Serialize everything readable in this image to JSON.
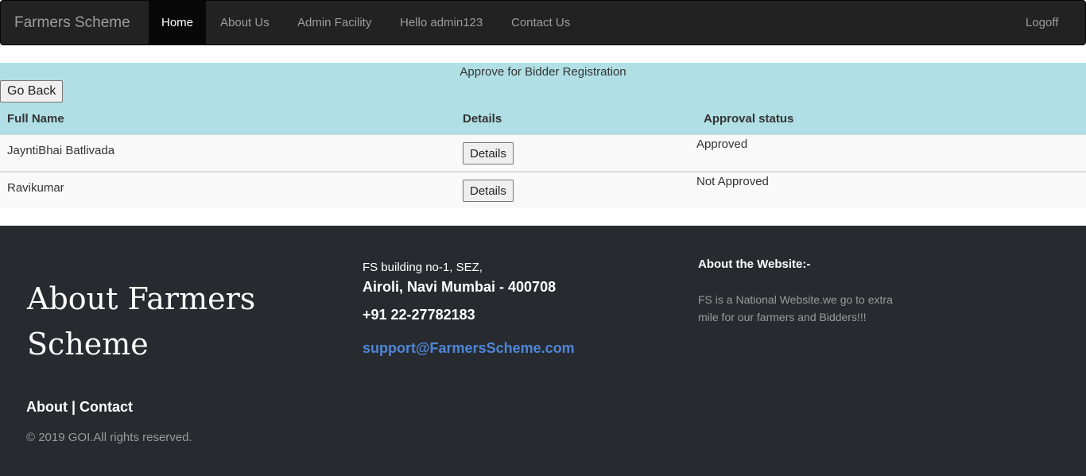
{
  "navbar": {
    "brand": "Farmers Scheme",
    "items": [
      {
        "label": "Home"
      },
      {
        "label": "About Us"
      },
      {
        "label": "Admin Facility"
      },
      {
        "label": "Hello admin123"
      },
      {
        "label": "Contact Us"
      }
    ],
    "logoff": "Logoff"
  },
  "approval": {
    "title": "Approve for Bidder Registration",
    "go_back": "Go Back",
    "columns": [
      "Full Name",
      "Details",
      "Approval status"
    ],
    "rows": [
      {
        "name": "JayntiBhai Batlivada",
        "details_label": "Details",
        "status": "Approved"
      },
      {
        "name": "Ravikumar",
        "details_label": "Details",
        "status": "Not Approved"
      }
    ]
  },
  "footer": {
    "heading": "About Farmers Scheme",
    "link_about": "About",
    "link_sep": " | ",
    "link_contact": "Contact",
    "copyright": "© 2019 GOI.All rights reserved.",
    "address_line1": "FS building no-1, SEZ,",
    "address_line2": "Airoli, Navi Mumbai - 400708",
    "phone": "+91 22-27782183",
    "email": "support@FarmersScheme.com",
    "about_title": "About the Website:-",
    "about_text": "FS is a National Website.we go to extra mile for our farmers and Bidders!!!"
  },
  "colors": {
    "navbar_bg": "#222222",
    "panel_bg": "#b0dfe5",
    "footer_bg": "#272b30",
    "email_link": "#4f86d8"
  }
}
